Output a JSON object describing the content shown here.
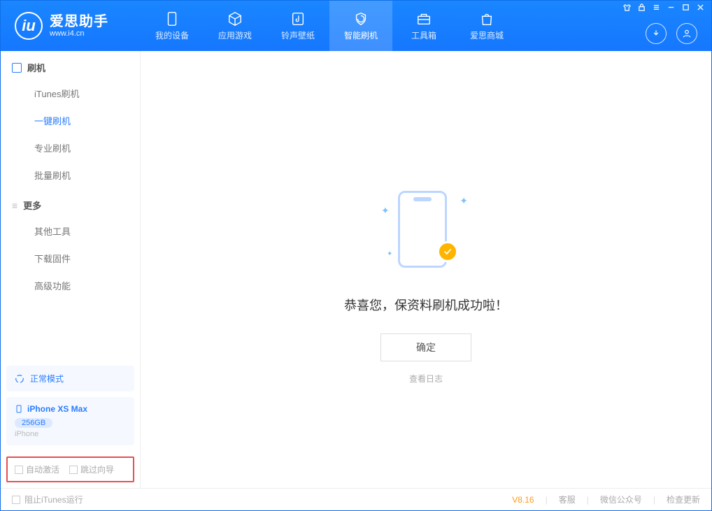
{
  "app": {
    "name": "爱思助手",
    "url": "www.i4.cn"
  },
  "header_tabs": {
    "device": "我的设备",
    "apps": "应用游戏",
    "ringtones": "铃声壁纸",
    "flash": "智能刷机",
    "tools": "工具箱",
    "store": "爱思商城"
  },
  "sidebar": {
    "section_flash": "刷机",
    "itunes_flash": "iTunes刷机",
    "one_click_flash": "一键刷机",
    "pro_flash": "专业刷机",
    "batch_flash": "批量刷机",
    "section_more": "更多",
    "other_tools": "其他工具",
    "download_firmware": "下载固件",
    "advanced": "高级功能"
  },
  "status": {
    "mode": "正常模式"
  },
  "device": {
    "name": "iPhone XS Max",
    "storage": "256GB",
    "type": "iPhone"
  },
  "options": {
    "auto_activate": "自动激活",
    "skip_guide": "跳过向导"
  },
  "main": {
    "success_text": "恭喜您，保资料刷机成功啦！",
    "ok_button": "确定",
    "view_log": "查看日志"
  },
  "footer": {
    "block_itunes": "阻止iTunes运行",
    "version": "V8.16",
    "support": "客服",
    "wechat": "微信公众号",
    "check_update": "检查更新"
  }
}
